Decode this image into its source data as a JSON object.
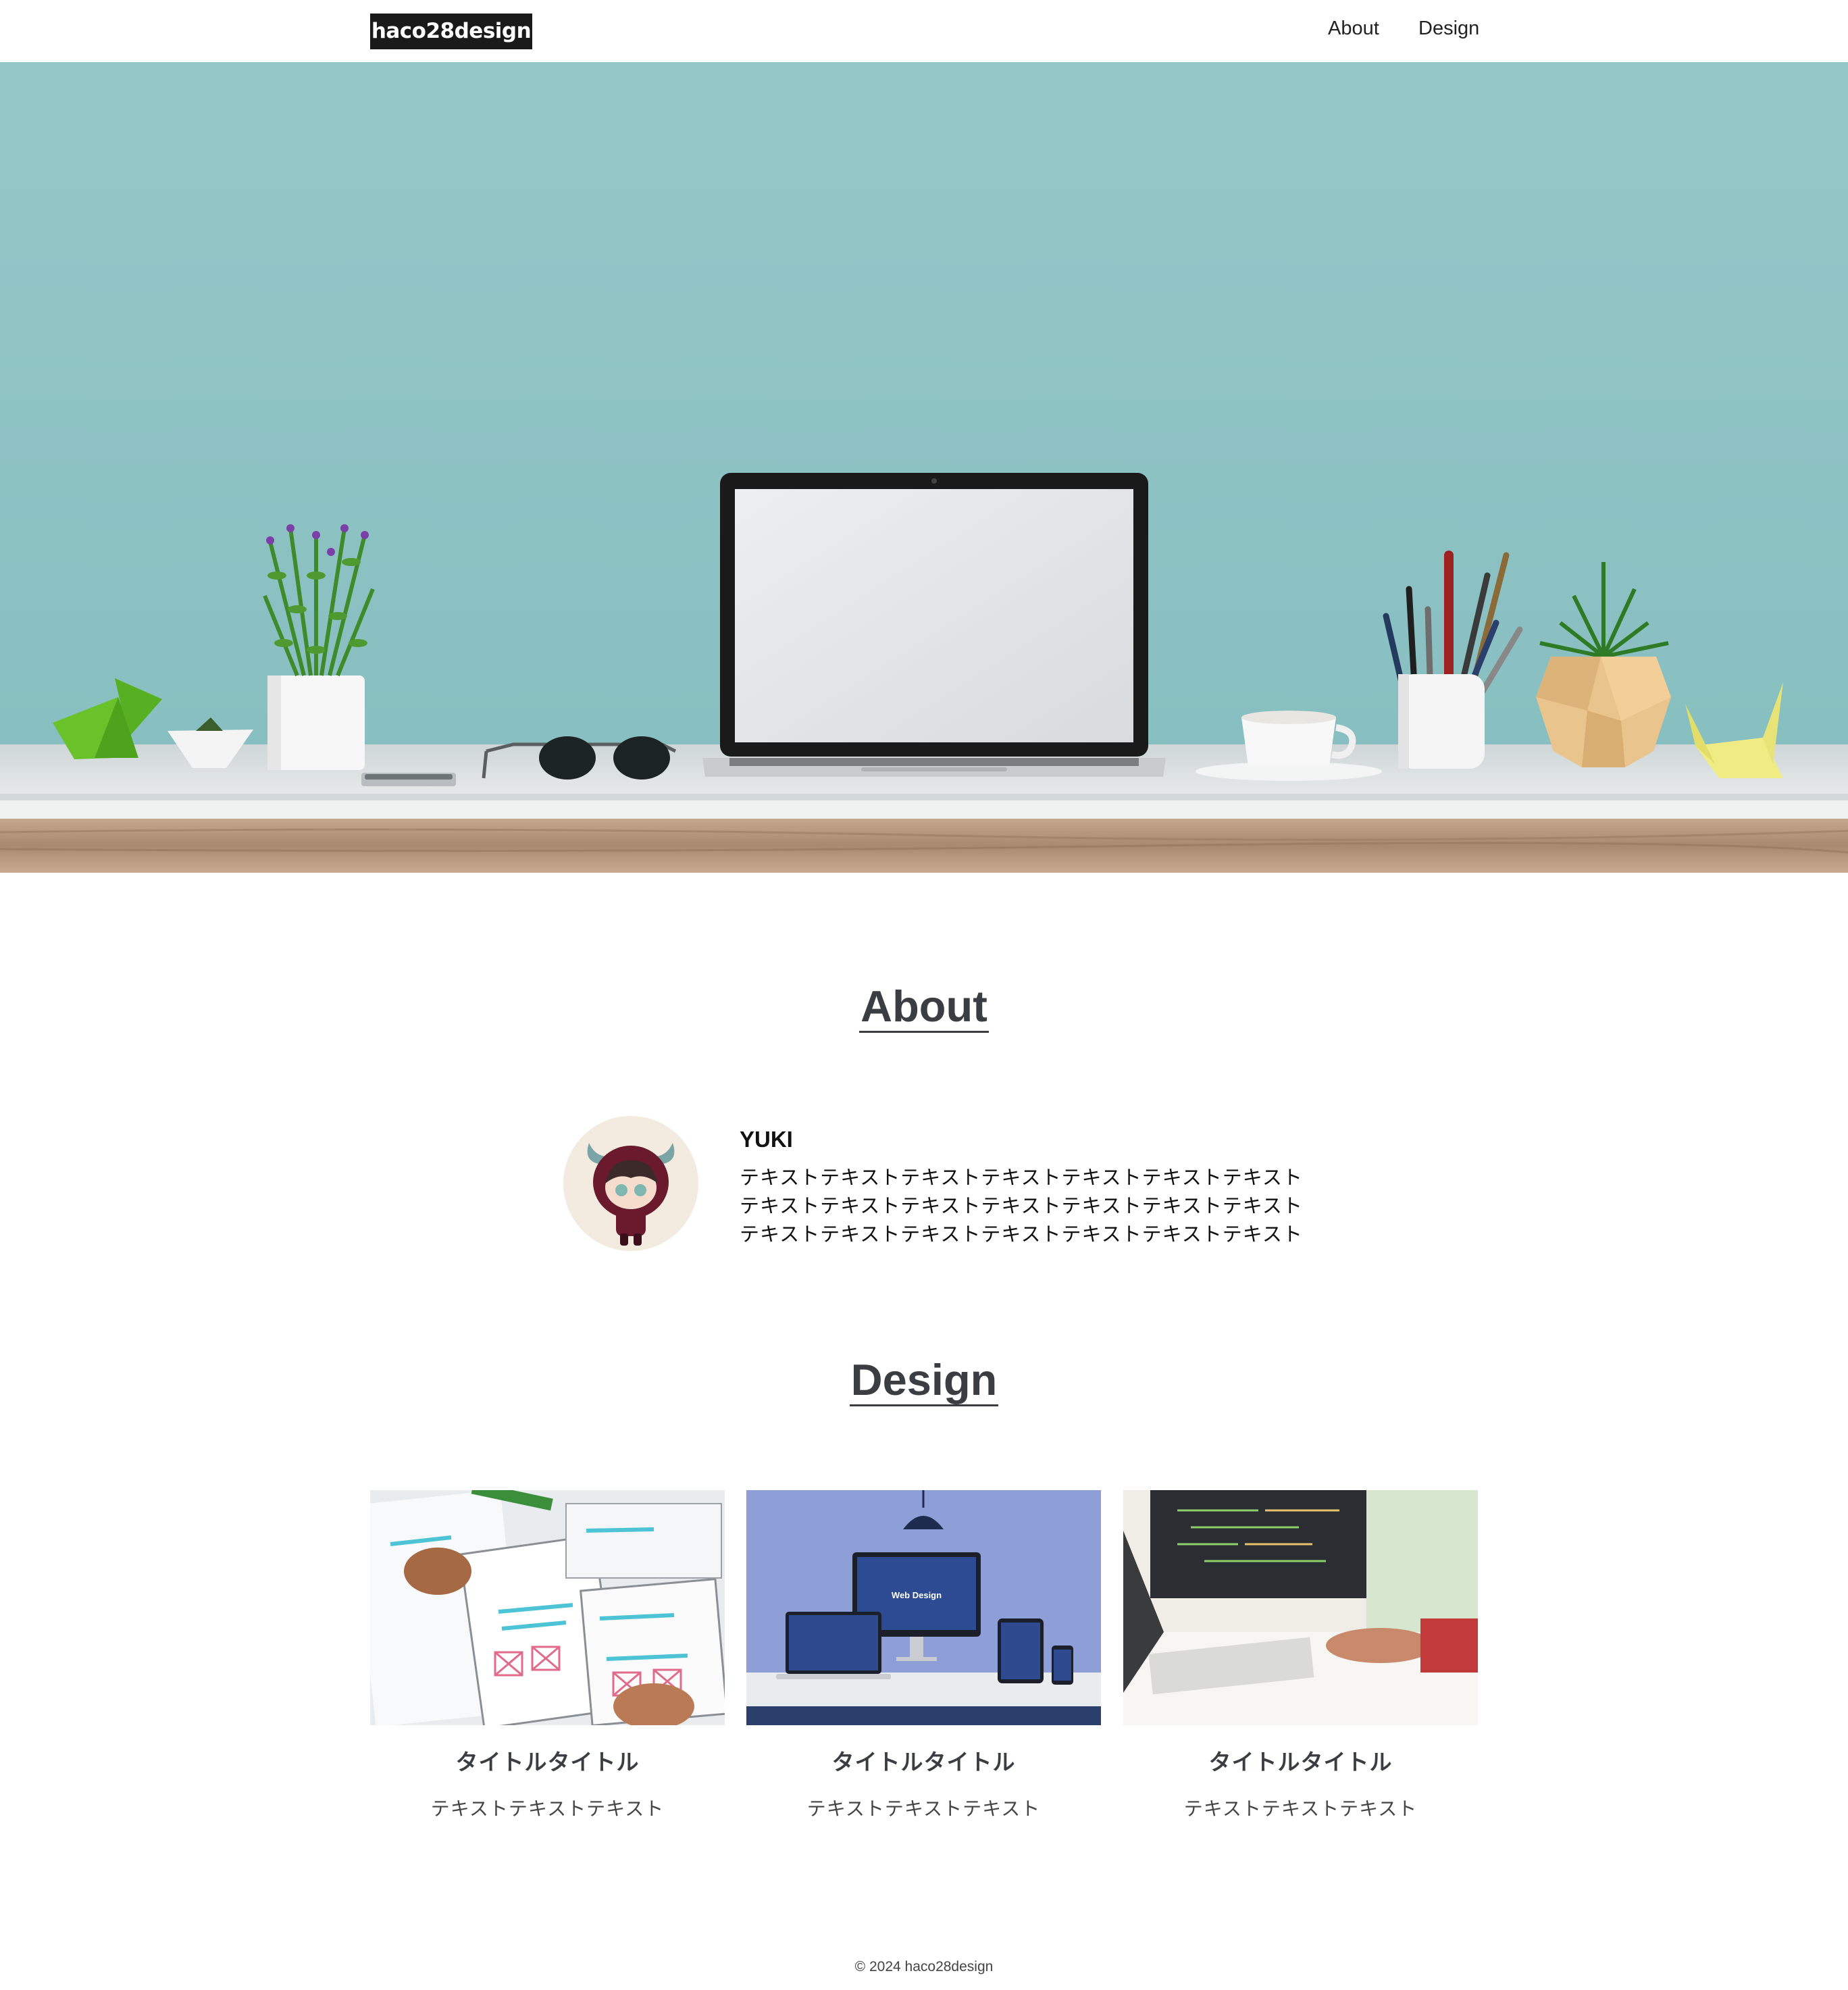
{
  "header": {
    "logo": "haco28design",
    "nav": [
      {
        "label": "About"
      },
      {
        "label": "Design"
      }
    ]
  },
  "hero": {
    "scene": "desk with laptop, plants, sunglasses, coffee cup, pen holder and origami on teal wall",
    "colors": {
      "wall": "#93c6c7",
      "desk": "#dfe3e4",
      "wood": "#b09178"
    }
  },
  "about": {
    "heading": "About",
    "name": "YUKI",
    "text_lines": [
      "テキストテキストテキストテキストテキストテキストテキスト",
      "テキストテキストテキストテキストテキストテキストテキスト",
      "テキストテキストテキストテキストテキストテキストテキスト"
    ]
  },
  "design": {
    "heading": "Design",
    "cards": [
      {
        "title": "タイトルタイトル",
        "text": "テキストテキストテキスト",
        "image": "wireframe-sketches-image"
      },
      {
        "title": "タイトルタイトル",
        "text": "テキストテキストテキスト",
        "image": "responsive-devices-image",
        "screen_text": "Web Design"
      },
      {
        "title": "タイトルタイトル",
        "text": "テキストテキストテキスト",
        "image": "coding-workspace-image"
      }
    ]
  },
  "footer": {
    "copyright": "© 2024 haco28design"
  },
  "colors": {
    "heading": "#3a3d42",
    "logo_bg": "#1a1a1a",
    "avatar_bg": "#f3ebe0"
  }
}
